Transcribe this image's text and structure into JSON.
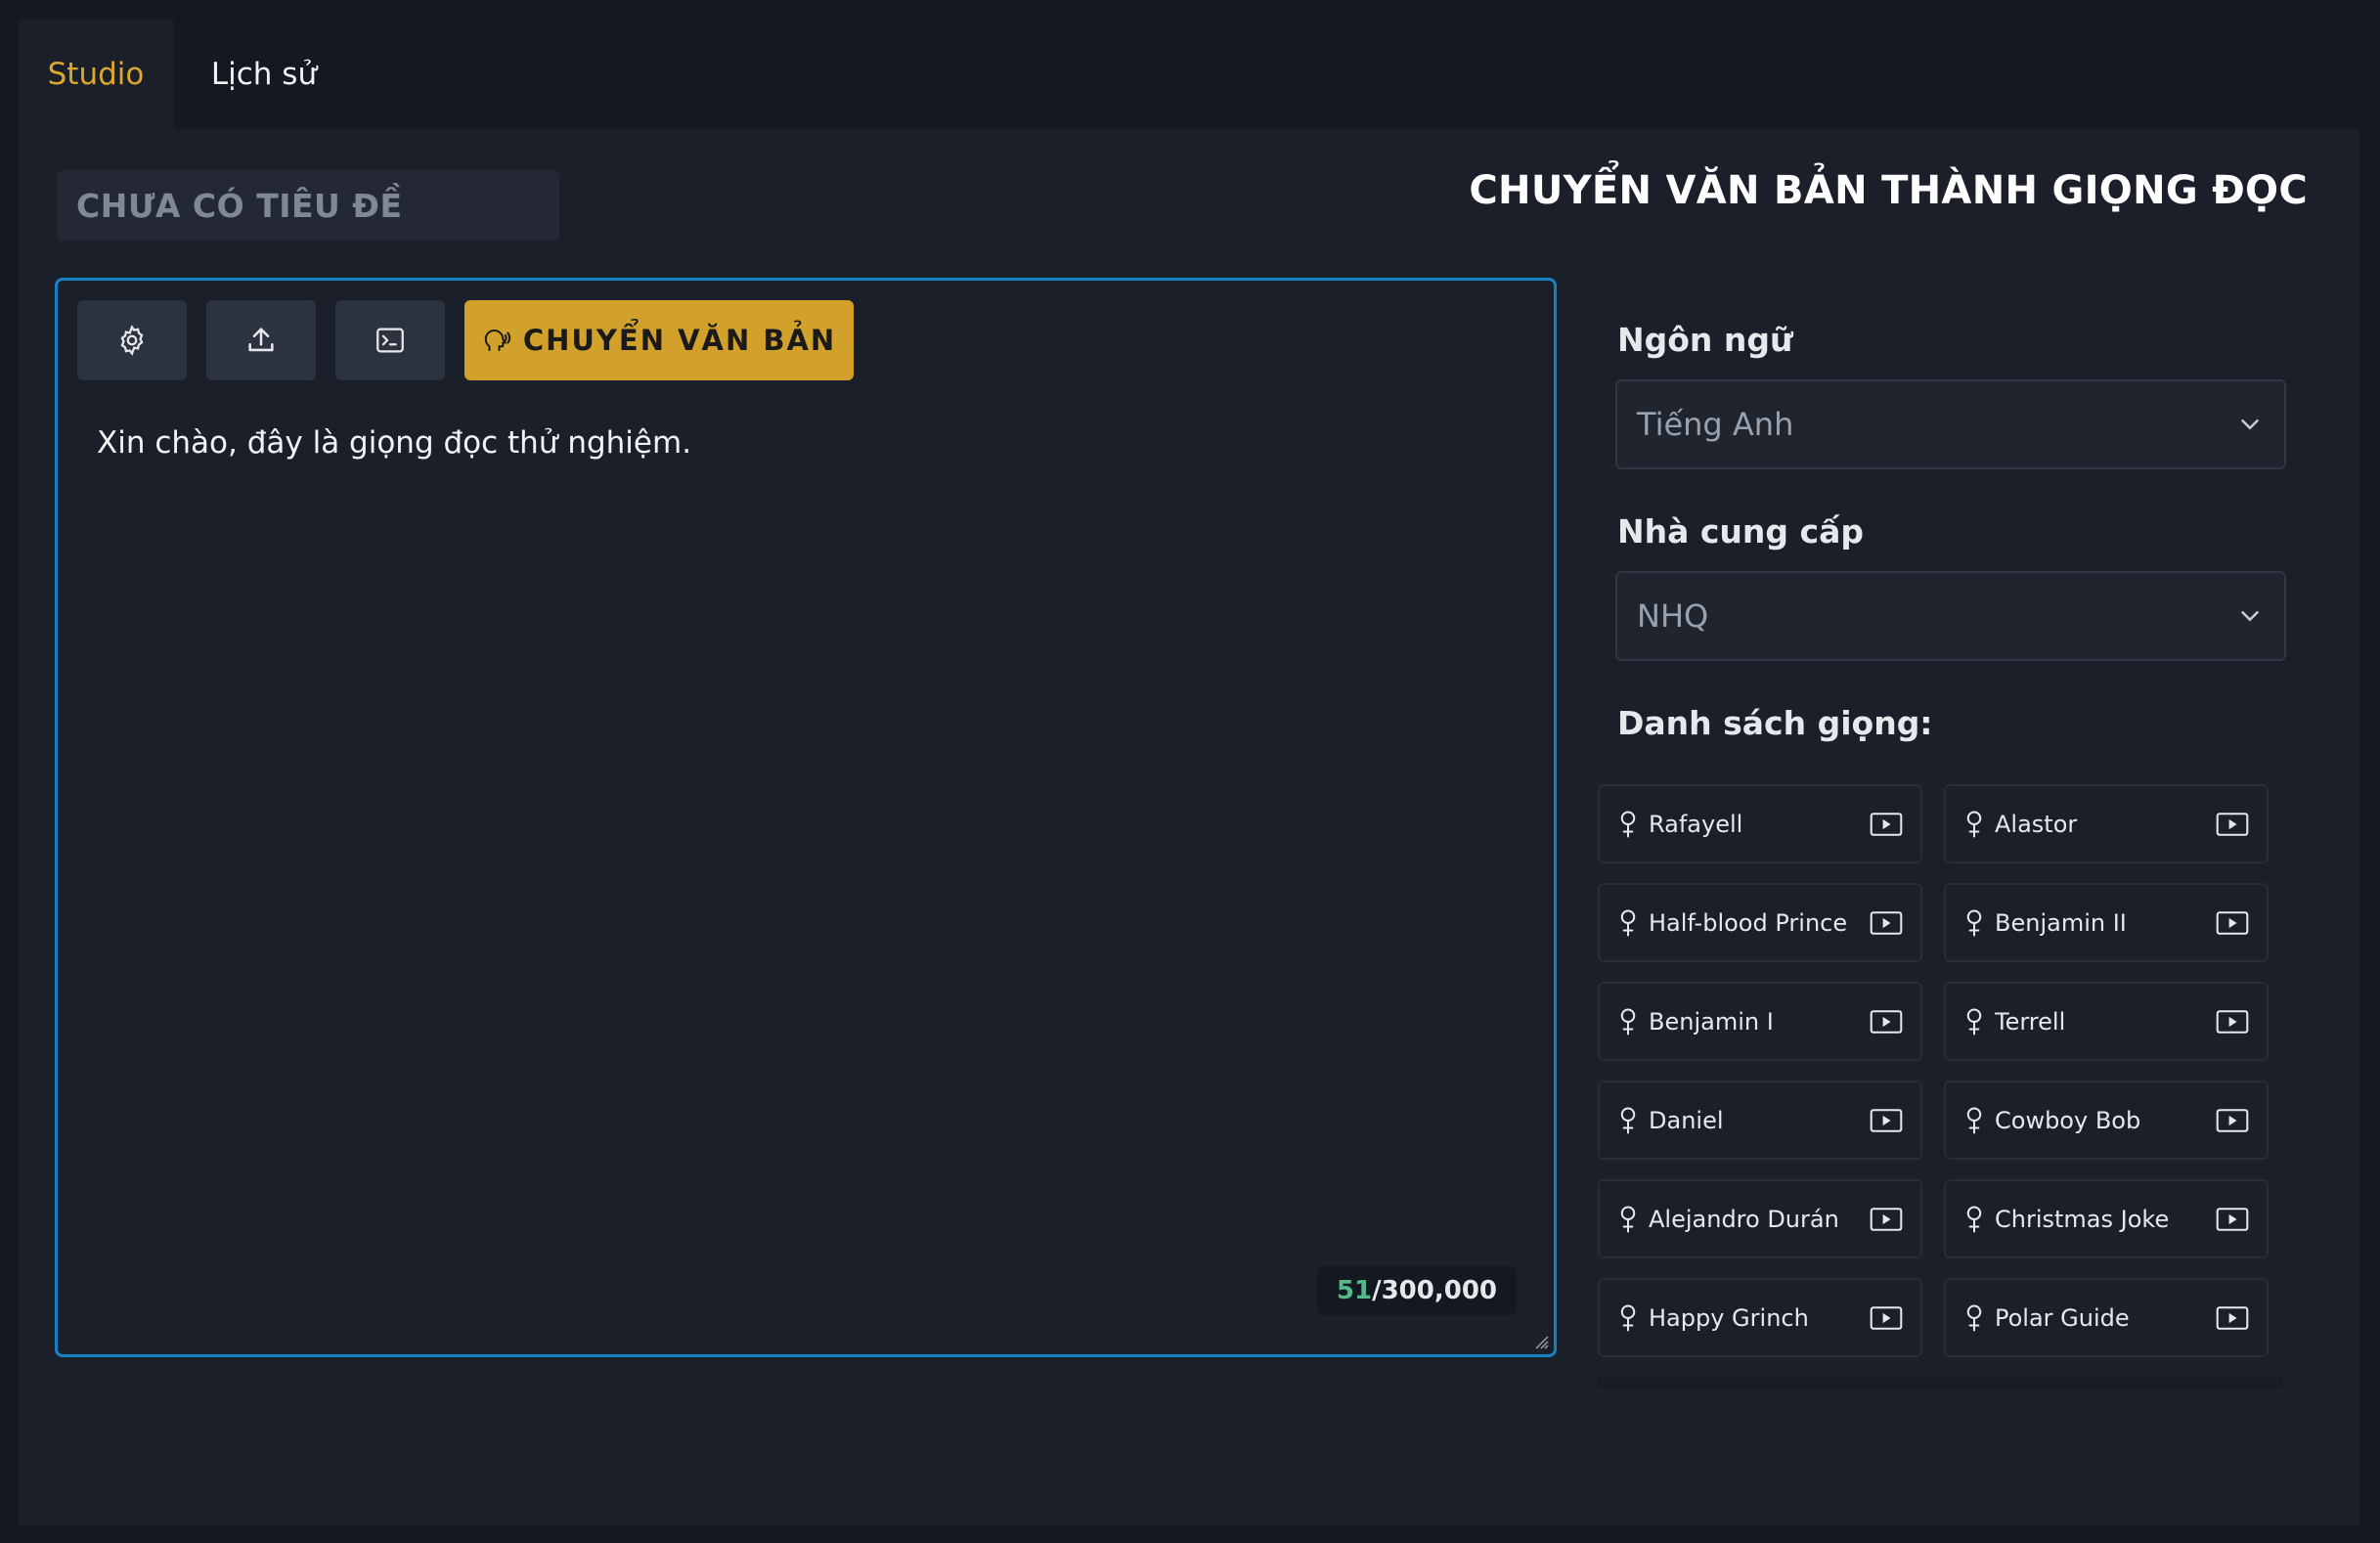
{
  "tabs": [
    {
      "label": "Studio",
      "active": true
    },
    {
      "label": "Lịch sử",
      "active": false
    }
  ],
  "document": {
    "title_placeholder": "CHƯA CÓ TIÊU ĐỀ"
  },
  "page_title": "CHUYỂN VĂN BẢN THÀNH GIỌNG ĐỌC",
  "toolbar": {
    "settings_icon": "gear-icon",
    "upload_icon": "upload-icon",
    "terminal_icon": "terminal-icon",
    "convert_label": "CHUYỂN VĂN BẢN"
  },
  "editor": {
    "text": "Xin chào, đây là giọng đọc thử nghiệm.",
    "char_used": "51",
    "char_limit": "/300,000"
  },
  "settings": {
    "language_label": "Ngôn ngữ",
    "language_value": "Tiếng Anh",
    "provider_label": "Nhà cung cấp",
    "provider_value": "NHQ",
    "voices_label": "Danh sách giọng:"
  },
  "voices": [
    "Rafayell",
    "Alastor",
    "Half-blood Prince",
    "Benjamin II",
    "Benjamin I",
    "Terrell",
    "Daniel",
    "Cowboy Bob",
    "Alejandro Durán",
    "Christmas Joke",
    "Happy Grinch",
    "Polar Guide"
  ],
  "colors": {
    "accent": "#d2a12c",
    "editor_border": "#1780c4",
    "counter_used": "#55b98a"
  }
}
